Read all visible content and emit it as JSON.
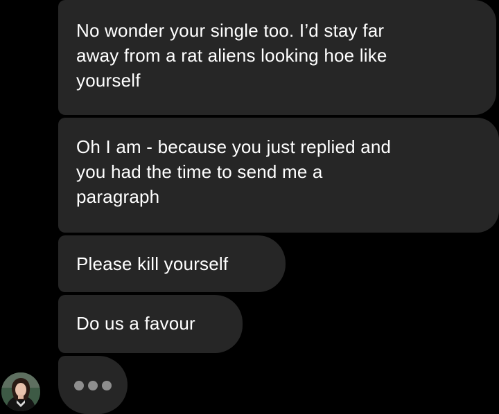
{
  "messages": [
    {
      "text": "No wonder your single too. I’d stay far\naway from a rat aliens looking hoe like\nyourself"
    },
    {
      "text": "Oh I am - because you just replied and\nyou had the time to send me a\nparagraph"
    },
    {
      "text": "Please kill yourself"
    },
    {
      "text": "Do us a favour"
    }
  ],
  "typing_indicator": {
    "icon": "typing-dots-icon",
    "dot_color": "#8e8e8e"
  },
  "sender": {
    "avatar_icon": "profile-avatar"
  },
  "colors": {
    "background": "#000000",
    "bubble": "#262626",
    "text": "#ffffff"
  }
}
